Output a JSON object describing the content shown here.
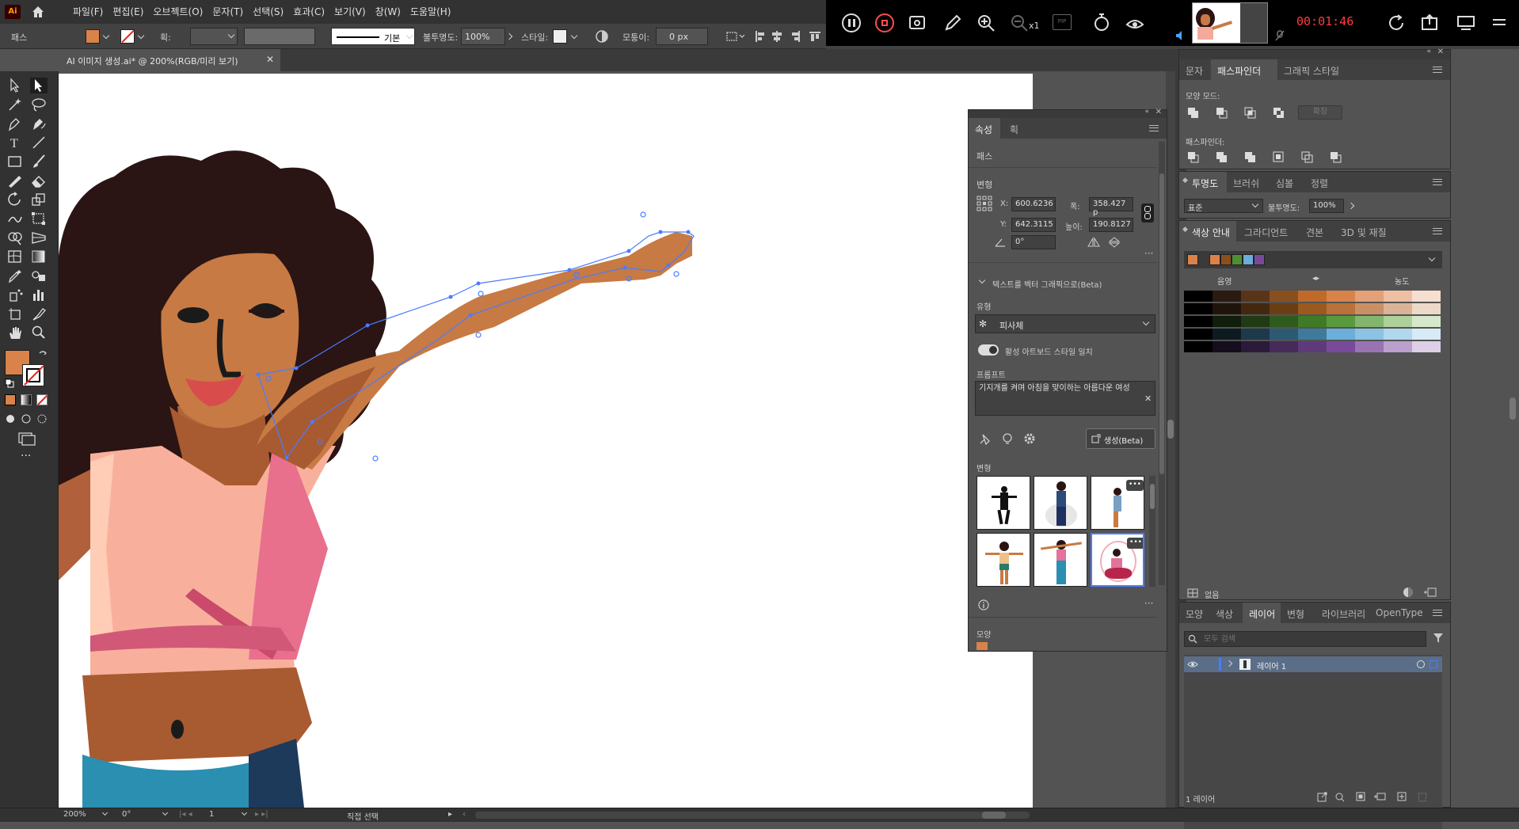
{
  "app": {
    "logo": "Ai",
    "menus": [
      "파일(F)",
      "편집(E)",
      "오브젝트(O)",
      "문자(T)",
      "선택(S)",
      "효과(C)",
      "보기(V)",
      "창(W)",
      "도움말(H)"
    ]
  },
  "recorder": {
    "timer": "00:01:46",
    "zoom_indicator": "x1",
    "pip_label": "PIP"
  },
  "controlbar": {
    "object_type": "패스",
    "stroke_label": "획:",
    "stroke_style": "기본",
    "opacity_label": "불투명도:",
    "opacity_value": "100%",
    "style_label": "스타일:",
    "corner_label": "모퉁이:",
    "corner_value": "0 px",
    "fill_color": "#d9824a"
  },
  "document": {
    "tab_title": "AI 이미지 생성.ai* @ 200%(RGB/미리 보기)"
  },
  "tools": {
    "fill_color": "#d9824a"
  },
  "properties_panel": {
    "tabs": [
      "속성",
      "획"
    ],
    "path_label": "패스",
    "transform_label": "변형",
    "x_label": "X:",
    "x_value": "600.6236",
    "y_label": "Y:",
    "y_value": "642.3115",
    "w_label": "폭:",
    "w_value": "358.427 p",
    "h_label": "높이:",
    "h_value": "190.8127",
    "angle_value": "0°",
    "text_to_vector_label": "텍스트를 벡터 그래픽으로(Beta)",
    "type_label": "유형",
    "type_value": "피사체",
    "match_style_label": "활성 아트보드 스타일 일치",
    "prompt_label": "프롬프트",
    "prompt_text": "기지개를 켜며 아침을 맞이하는 아름다운 여성",
    "generate_label": "생성(Beta)",
    "variations_label": "변형",
    "appearance_label": "모양"
  },
  "pathfinder_panel": {
    "tabs": [
      "문자",
      "패스파인더",
      "그래픽 스타일"
    ],
    "shape_modes_label": "모양 모드:",
    "expand_label": "확장",
    "pathfinders_label": "패스파인더:"
  },
  "transparency_panel": {
    "tabs": [
      "투명도",
      "브러쉬",
      "심볼",
      "정렬"
    ],
    "blend_mode": "표준",
    "opacity_label": "불투명도:",
    "opacity_value": "100%"
  },
  "color_guide_panel": {
    "tabs": [
      "색상 안내",
      "그라디언트",
      "견본",
      "3D 및 재질"
    ],
    "shade_label": "음영",
    "tint_label": "농도",
    "footer_label": "없음",
    "harmony_colors": [
      "#d9824a",
      "#d9824a",
      "#8a4f1e",
      "#4e8f35",
      "#6aaed9",
      "#7a4a9a"
    ],
    "grid_rows": [
      [
        "#000000",
        "#2b1a10",
        "#5a3418",
        "#8a4f1e",
        "#c06a2a",
        "#d9824a",
        "#e4a077",
        "#eebfa3",
        "#f6dfd0"
      ],
      [
        "#000000",
        "#1f140c",
        "#42280f",
        "#6a3e15",
        "#9a5a1e",
        "#b9723a",
        "#c99066",
        "#d9b497",
        "#ecd9c9"
      ],
      [
        "#000000",
        "#101d0b",
        "#1f3a14",
        "#2e5a1d",
        "#3f7a27",
        "#5a9a3f",
        "#83b56c",
        "#aed09b",
        "#d6e8cc"
      ],
      [
        "#000000",
        "#0e1a22",
        "#1d3a4a",
        "#2d5a73",
        "#3f7a9a",
        "#6aaed9",
        "#8cc3e3",
        "#b0d7ee",
        "#d7ebf6"
      ],
      [
        "#000000",
        "#150d1c",
        "#2c1a3a",
        "#452a5a",
        "#5f3a7a",
        "#7a4a9a",
        "#9a73b3",
        "#bb9fcc",
        "#ddcfe6"
      ]
    ]
  },
  "layers_panel": {
    "tabs": [
      "모양",
      "색상",
      "레이어",
      "변형",
      "라이브러리",
      "OpenType"
    ],
    "search_placeholder": "모두 검색",
    "layer_name": "레이어 1",
    "footer_count": "1 레이어"
  },
  "statusbar": {
    "zoom": "200%",
    "rotation": "0°",
    "artboard": "1",
    "tool_name": "직접 선택"
  }
}
